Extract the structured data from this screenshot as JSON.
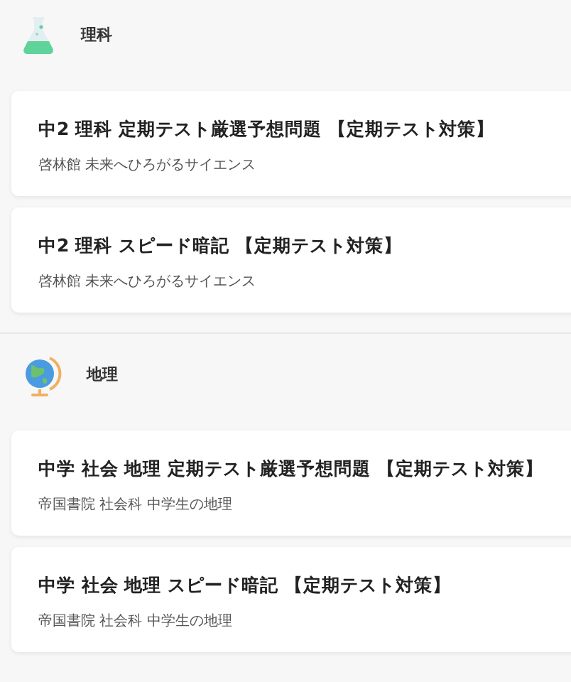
{
  "sections": [
    {
      "kind": "flask",
      "title": "理科",
      "items": [
        {
          "title": "中2 理科 定期テスト厳選予想問題 【定期テスト対策】",
          "subtitle": "啓林館 未来へひろがるサイエンス"
        },
        {
          "title": "中2 理科 スピード暗記 【定期テスト対策】",
          "subtitle": "啓林館 未来へひろがるサイエンス"
        }
      ]
    },
    {
      "kind": "globe",
      "title": "地理",
      "items": [
        {
          "title": "中学 社会 地理 定期テスト厳選予想問題 【定期テスト対策】",
          "subtitle": "帝国書院 社会科 中学生の地理"
        },
        {
          "title": "中学 社会 地理 スピード暗記 【定期テスト対策】",
          "subtitle": "帝国書院 社会科 中学生の地理"
        }
      ]
    }
  ]
}
